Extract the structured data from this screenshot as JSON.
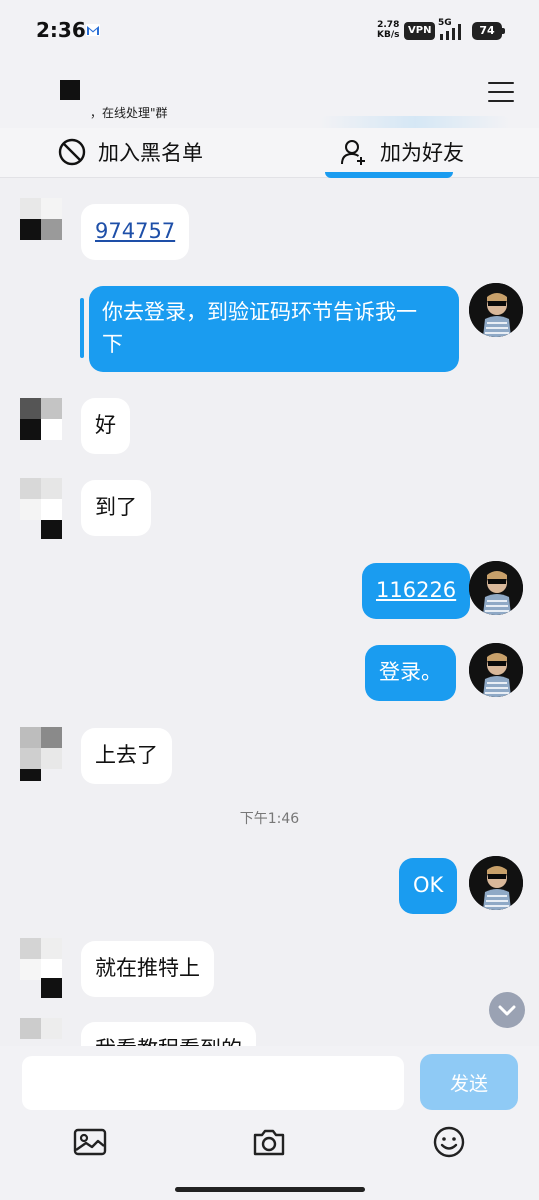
{
  "status_bar": {
    "time": "2:36",
    "net_speed_value": "2.78",
    "net_speed_unit": "KB/s",
    "vpn": "VPN",
    "network": "5G",
    "battery": "74"
  },
  "header": {
    "subtitle": "，在线处理\"群"
  },
  "action_bar": {
    "blacklist_label": "加入黑名单",
    "add_friend_label": "加为好友"
  },
  "messages": [
    {
      "side": "in",
      "text": "974757",
      "link": true
    },
    {
      "side": "out",
      "line1": "你去登录，到验证码环节告诉我一",
      "line2": "下"
    },
    {
      "side": "in",
      "text": "好"
    },
    {
      "side": "in",
      "text": "到了"
    },
    {
      "side": "out",
      "text": "116226",
      "link": true
    },
    {
      "side": "out",
      "text": "登录。"
    },
    {
      "side": "in",
      "text": "上去了"
    },
    {
      "side": "out",
      "text": "OK"
    },
    {
      "side": "in",
      "text": "就在推特上"
    },
    {
      "side": "in",
      "text": "我看教程看到的"
    }
  ],
  "timestamp": "下午1:46",
  "input": {
    "placeholder": "",
    "send_label": "发送"
  },
  "colors": {
    "outgoing_bubble": "#1a9cf0",
    "incoming_bubble": "#ffffff",
    "background": "#f0f0f3",
    "send_button": "#8fcaf5"
  },
  "icons": {
    "blacklist": "block-icon",
    "add_friend": "add-user-icon",
    "menu": "menu-icon",
    "image": "image-icon",
    "camera": "camera-icon",
    "emoji": "emoji-icon",
    "scroll_down": "chevron-down-icon"
  }
}
